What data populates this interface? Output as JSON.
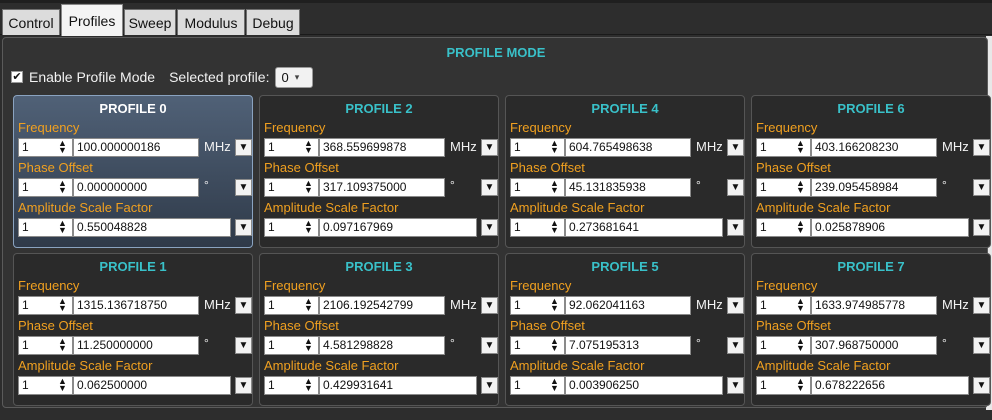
{
  "tabs": [
    {
      "label": "Control",
      "active": false
    },
    {
      "label": "Profiles",
      "active": true
    },
    {
      "label": "Sweep",
      "active": false
    },
    {
      "label": "Modulus",
      "active": false
    },
    {
      "label": "Debug",
      "active": false
    }
  ],
  "panel": {
    "title": "PROFILE MODE",
    "enable_checked": true,
    "enable_label": "Enable Profile Mode",
    "selected_label": "Selected profile:",
    "selected_value": "0"
  },
  "labels": {
    "frequency": "Frequency",
    "phase": "Phase Offset",
    "amplitude": "Amplitude Scale Factor",
    "unit_mhz": "MHz",
    "unit_deg": "°",
    "spin_value": "1"
  },
  "profiles": [
    {
      "title": "PROFILE 0",
      "frequency": "100.000000186",
      "phase": "0.000000000",
      "amplitude": "0.550048828"
    },
    {
      "title": "PROFILE 1",
      "frequency": "1315.136718750",
      "phase": "11.250000000",
      "amplitude": "0.062500000"
    },
    {
      "title": "PROFILE 2",
      "frequency": "368.559699878",
      "phase": "317.109375000",
      "amplitude": "0.097167969"
    },
    {
      "title": "PROFILE 3",
      "frequency": "2106.192542799",
      "phase": "4.581298828",
      "amplitude": "0.429931641"
    },
    {
      "title": "PROFILE 4",
      "frequency": "604.765498638",
      "phase": "45.131835938",
      "amplitude": "0.273681641"
    },
    {
      "title": "PROFILE 5",
      "frequency": "92.062041163",
      "phase": "7.075195313",
      "amplitude": "0.003906250"
    },
    {
      "title": "PROFILE 6",
      "frequency": "403.166208230",
      "phase": "239.095458984",
      "amplitude": "0.025878906"
    },
    {
      "title": "PROFILE 7",
      "frequency": "1633.974985778",
      "phase": "307.968750000",
      "amplitude": "0.678222656"
    }
  ],
  "colors": {
    "accent_title": "#39c1c9",
    "field_label": "#f0a020",
    "selected_card": "#506177"
  },
  "icons": {
    "check": "check-icon",
    "spinner": "spinner-arrows-icon",
    "dropdown": "chevron-down-icon"
  }
}
